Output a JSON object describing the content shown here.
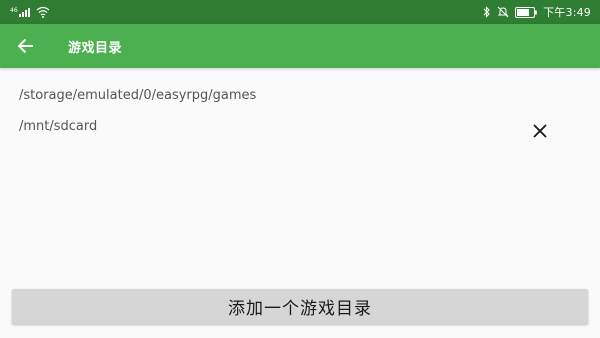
{
  "status_bar": {
    "signal_label": "46",
    "battery_percent": 0.75,
    "time": "下午3:49",
    "icons": [
      "signal-icon",
      "wifi-icon",
      "bluetooth-icon",
      "mute-icon",
      "battery-icon"
    ]
  },
  "app_bar": {
    "title": "游戏目录",
    "back_icon": "arrow-left-icon",
    "color": "#4caf50"
  },
  "paths": [
    {
      "path": "/storage/emulated/0/easyrpg/games",
      "removable": false
    },
    {
      "path": "/mnt/sdcard",
      "removable": true
    }
  ],
  "add_button": {
    "label": "添加一个游戏目录"
  },
  "colors": {
    "status_bar": "#2f7d32",
    "background": "#fafafa",
    "button": "#d6d6d6"
  }
}
